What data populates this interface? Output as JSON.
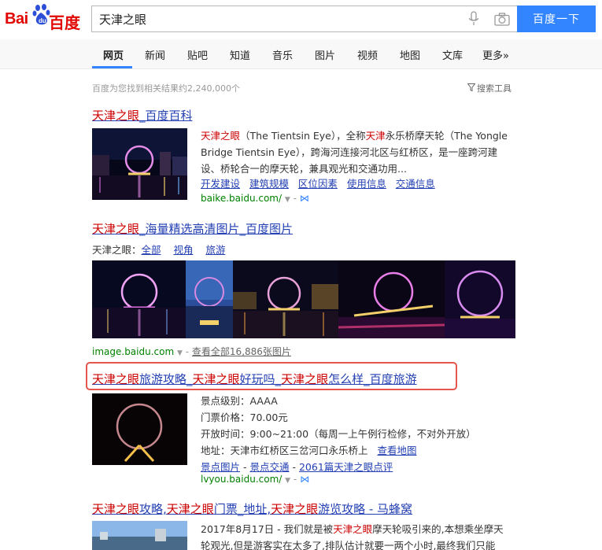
{
  "header": {
    "logo_left": "Bai",
    "logo_right": "百度",
    "search_value": "天津之眼",
    "search_button": "百度一下"
  },
  "tabs": [
    "网页",
    "新闻",
    "贴吧",
    "知道",
    "音乐",
    "图片",
    "视频",
    "地图",
    "文库",
    "更多»"
  ],
  "meta": {
    "result_count": "百度为您找到相关结果约2,240,000个",
    "search_tools": "搜索工具"
  },
  "result1": {
    "title_hl": "天津之眼",
    "title_rest": "_百度百科",
    "snippet_lines": [
      [
        "天津之眼",
        "（The Tientsin Eye），全称",
        "天津",
        "永乐桥摩天轮（The Yongle"
      ],
      [
        "Bridge Tientsin Eye），跨海河连接河北区与红桥区，是一座跨河建"
      ],
      [
        "设、桥轮合一的摩天轮，兼具观光和交通功用..."
      ]
    ],
    "links": [
      "开发建设",
      "建筑规模",
      "区位因素",
      "使用信息",
      "交通信息"
    ],
    "url": "baike.baidu.com/"
  },
  "result2": {
    "title_hl": "天津之眼",
    "title_rest": "_海量精选高清图片_百度图片",
    "tag_label": "天津之眼：",
    "tags": [
      "全部",
      "视角",
      "旅游"
    ],
    "url": "image.baidu.com",
    "more_link": "查看全部16,886张图片"
  },
  "result3": {
    "title_parts": [
      {
        "t": "天津之眼",
        "hl": true
      },
      {
        "t": "旅游攻略_",
        "hl": false
      },
      {
        "t": "天津之眼",
        "hl": true
      },
      {
        "t": "好玩吗_",
        "hl": false
      },
      {
        "t": "天津之眼",
        "hl": true
      },
      {
        "t": "怎么样_百度旅游",
        "hl": false
      }
    ],
    "level": "景点级别：AAAA",
    "price": "门票价格：70.00元",
    "hours": "开放时间：9:00~21:00（每周一上午例行检修，不对外开放）",
    "address": "地址：天津市红桥区三岔河口永乐桥上",
    "map_link": "查看地图",
    "link_a": "景点图片",
    "link_b": "景点交通",
    "link_c": "2061篇天津之眼点评",
    "url": "lvyou.baidu.com/"
  },
  "result4": {
    "title_parts": [
      {
        "t": "天津之眼",
        "hl": true
      },
      {
        "t": "攻略,",
        "hl": false
      },
      {
        "t": "天津之眼",
        "hl": true
      },
      {
        "t": "门票_地址,",
        "hl": false
      },
      {
        "t": "天津之眼",
        "hl": true
      },
      {
        "t": "游览攻略 - 马蜂窝",
        "hl": false
      }
    ],
    "line1_a": "2017年8月17日 - 我们就是被",
    "line1_hl": "天津之眼",
    "line1_b": "摩天轮吸引来的,本想乘坐摩天",
    "line2": "轮观光,但是游客实在太多了,排队估计就要一两个小时,最终我们只能"
  },
  "colors": {
    "brand_red": "#e10601",
    "brand_blue": "#3385ff",
    "link": "#2440b3",
    "highlight": "#cc0000",
    "url_green": "#008000",
    "box": "#e5554b"
  }
}
